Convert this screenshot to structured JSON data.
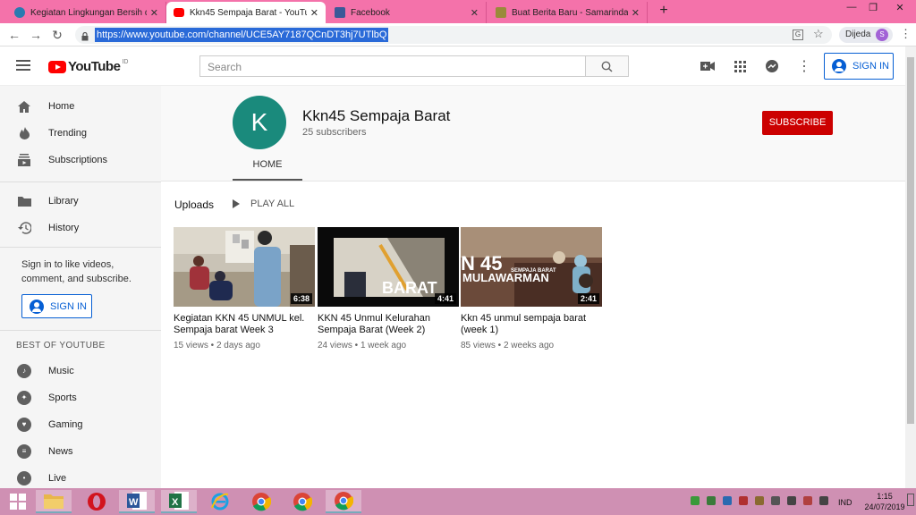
{
  "browser": {
    "tabs": [
      {
        "title": "Kegiatan Lingkungan Bersih dan",
        "icon": "wordpress-icon"
      },
      {
        "title": "Kkn45 Sempaja Barat - YouTube",
        "icon": "youtube-icon"
      },
      {
        "title": "Facebook",
        "icon": "facebook-icon"
      },
      {
        "title": "Buat Berita Baru - Samarinda City",
        "icon": "site-icon"
      }
    ],
    "url": "https://www.youtube.com/channel/UCE5AY7187QCnDT3hj7UTlbQ",
    "profile_name": "Dijeda",
    "profile_initial": "S"
  },
  "header": {
    "logo": "YouTube",
    "country": "ID",
    "search_placeholder": "Search",
    "sign_in": "SIGN IN"
  },
  "sidebar": {
    "items": [
      {
        "label": "Home",
        "icon": "home-icon"
      },
      {
        "label": "Trending",
        "icon": "flame-icon"
      },
      {
        "label": "Subscriptions",
        "icon": "subscriptions-icon"
      },
      {
        "label": "Library",
        "icon": "folder-icon"
      },
      {
        "label": "History",
        "icon": "history-icon"
      }
    ],
    "signin_prompt": "Sign in to like videos, comment, and subscribe.",
    "signin_label": "SIGN IN",
    "best_title": "BEST OF YOUTUBE",
    "best": [
      {
        "label": "Music",
        "icon": "music-icon"
      },
      {
        "label": "Sports",
        "icon": "sports-icon"
      },
      {
        "label": "Gaming",
        "icon": "gaming-icon"
      },
      {
        "label": "News",
        "icon": "news-icon"
      },
      {
        "label": "Live",
        "icon": "live-icon"
      }
    ]
  },
  "channel": {
    "initial": "K",
    "name": "Kkn45 Sempaja Barat",
    "subscribers": "25 subscribers",
    "subscribe": "SUBSCRIBE",
    "tab": "HOME",
    "avatar_color": "#1a8a7c"
  },
  "uploads": {
    "title": "Uploads",
    "play_all": "PLAY ALL",
    "videos": [
      {
        "title": "Kegiatan KKN 45 UNMUL kel. Sempaja barat Week 3",
        "duration": "6:38",
        "views": "15 views",
        "age": "2 days ago"
      },
      {
        "title": "KKN 45 Unmul Kelurahan Sempaja Barat (Week 2)",
        "duration": "4:41",
        "views": "24 views",
        "age": "1 week ago",
        "overlay": "BARAT"
      },
      {
        "title": "Kkn 45 unmul sempaja barat (week 1)",
        "duration": "2:41",
        "views": "85 views",
        "age": "2 weeks ago",
        "overlay1": "N 45",
        "overlay2": "MULAWARMAN",
        "overlay3": "SEMPAJA BARAT"
      }
    ]
  },
  "taskbar": {
    "lang": "IND",
    "time": "1:15",
    "date": "24/07/2019"
  },
  "colors": {
    "tabstrip": "#f472aa",
    "taskbar": "#cf90b3",
    "subscribe": "#cc0000",
    "link_blue": "#065fd4"
  }
}
